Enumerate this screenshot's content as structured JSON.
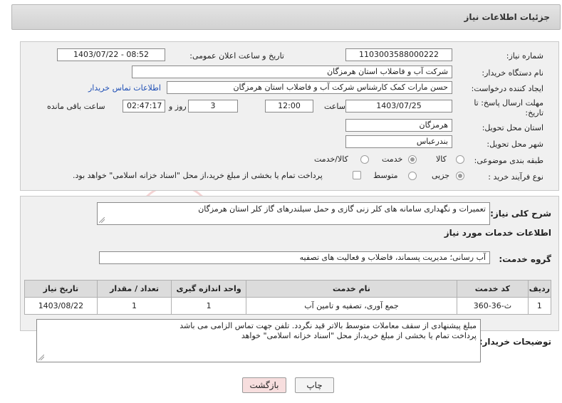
{
  "header": {
    "title": "جزئیات اطلاعات نیاز"
  },
  "form": {
    "need_number_label": "شماره نیاز:",
    "need_number": "1103003588000222",
    "announce_label": "تاریخ و ساعت اعلان عمومی:",
    "announce_value": "1403/07/22 - 08:52",
    "buyer_org_label": "نام دستگاه خریدار:",
    "buyer_org": "شرکت آب و فاضلاب استان هرمزگان",
    "creator_label": "ایجاد کننده درخواست:",
    "creator": "حسن مارات کمک کارشناس شرکت آب و فاضلاب استان هرمزگان",
    "contact_link": "اطلاعات تماس خریدار",
    "deadline_label_1": "مهلت ارسال پاسخ: تا",
    "deadline_label_2": "تاریخ:",
    "deadline_date": "1403/07/25",
    "time_label": "ساعت",
    "deadline_time": "12:00",
    "days_value": "3",
    "days_label": "روز و",
    "remaining_time": "02:47:17",
    "remaining_label": "ساعت باقی مانده",
    "province_label": "استان محل تحویل:",
    "province": "هرمزگان",
    "city_label": "شهر محل تحویل:",
    "city": "بندرعباس",
    "category_label": "طبقه بندی موضوعی:",
    "category_options": [
      "کالا",
      "خدمت",
      "کالا/خدمت"
    ],
    "category_selected": "خدمت",
    "process_label": "نوع فرآیند خرید :",
    "process_options": [
      "جزیی",
      "متوسط"
    ],
    "process_selected": "جزیی",
    "payment_note": "پرداخت تمام یا بخشی از مبلغ خرید،از محل \"اسناد خزانه اسلامی\" خواهد بود."
  },
  "summary": {
    "label": "شرح کلی نیاز:",
    "text": "تعمیرات و  نگهداری سامانه های کلر زنی گازی و حمل سیلندرهای گاز کلر استان هرمزگان"
  },
  "services": {
    "section_title": "اطلاعات خدمات مورد نیاز",
    "group_label": "گروه خدمت:",
    "group_value": "آب رسانی؛ مدیریت پسماند، فاضلاب و فعالیت های تصفیه",
    "columns": [
      "ردیف",
      "کد خدمت",
      "نام خدمت",
      "واحد اندازه گیری",
      "تعداد / مقدار",
      "تاریخ نیاز"
    ],
    "rows": [
      [
        "1",
        "ث-36-360",
        "جمع آوری، تصفیه و تامین آب",
        "1",
        "1",
        "1403/08/22"
      ]
    ]
  },
  "buyer_notes": {
    "label": "توضیحات خریدار:",
    "line1": "مبلغ پیشنهادی از سقف معاملات متوسط بالاتر قید نگردد. تلفن جهت تماس الزامی می باشد",
    "line2": "پرداخت تمام یا بخشی از مبلغ خرید،از محل \"اسناد خزانه اسلامی\" خواهد"
  },
  "buttons": {
    "print": "چاپ",
    "back": "بازگشت"
  },
  "colors": {
    "link": "#1f4fb5",
    "back_button": "#f7dede",
    "print_button": "#f4f4f4"
  }
}
